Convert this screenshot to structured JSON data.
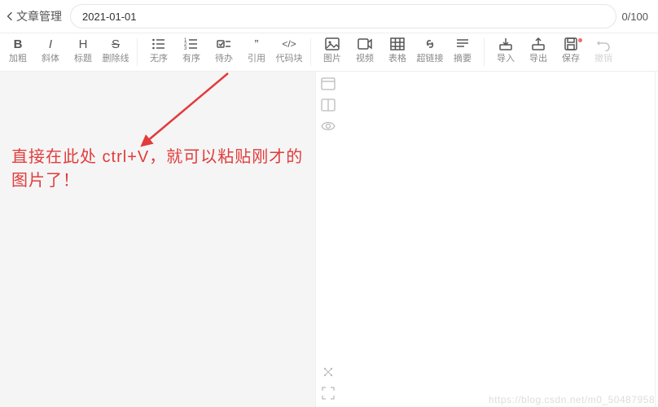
{
  "header": {
    "back_label": "文章管理",
    "title_value": "2021-01-01",
    "counter": "0/100"
  },
  "toolbar": {
    "groups": [
      [
        {
          "id": "bold",
          "label": "加粗",
          "glyph": "B",
          "bold": true
        },
        {
          "id": "italic",
          "label": "斜体",
          "glyph": "I",
          "italic": true
        },
        {
          "id": "heading",
          "label": "标题",
          "glyph": "H"
        },
        {
          "id": "strike",
          "label": "删除线",
          "glyph": "S",
          "strike": true
        }
      ],
      [
        {
          "id": "ul",
          "label": "无序",
          "svg": "ul"
        },
        {
          "id": "ol",
          "label": "有序",
          "svg": "ol"
        },
        {
          "id": "todo",
          "label": "待办",
          "svg": "todo"
        },
        {
          "id": "quote",
          "label": "引用",
          "glyph": "”"
        },
        {
          "id": "code",
          "label": "代码块",
          "glyph": "</>"
        }
      ],
      [
        {
          "id": "image",
          "label": "图片",
          "svg": "image"
        },
        {
          "id": "video",
          "label": "视频",
          "svg": "video"
        },
        {
          "id": "table",
          "label": "表格",
          "svg": "table"
        },
        {
          "id": "link",
          "label": "超链接",
          "svg": "link"
        },
        {
          "id": "summary",
          "label": "摘要",
          "svg": "summary"
        }
      ],
      [
        {
          "id": "import",
          "label": "导入",
          "svg": "import"
        },
        {
          "id": "export",
          "label": "导出",
          "svg": "export"
        },
        {
          "id": "save",
          "label": "保存",
          "svg": "save",
          "dot": true
        },
        {
          "id": "undo",
          "label": "撤销",
          "svg": "undo",
          "dim": true
        }
      ]
    ]
  },
  "side_icons_top": [
    {
      "id": "panel",
      "svg": "panel"
    },
    {
      "id": "split",
      "svg": "split"
    },
    {
      "id": "eye",
      "svg": "eye"
    }
  ],
  "side_icons_bottom": [
    {
      "id": "expand",
      "svg": "expand"
    },
    {
      "id": "fullscreen",
      "svg": "fullscreen"
    }
  ],
  "editor_hint": "直接在此处 ctrl+V，就可以粘贴刚才的图片了！",
  "watermark": "https://blog.csdn.net/m0_50487958"
}
